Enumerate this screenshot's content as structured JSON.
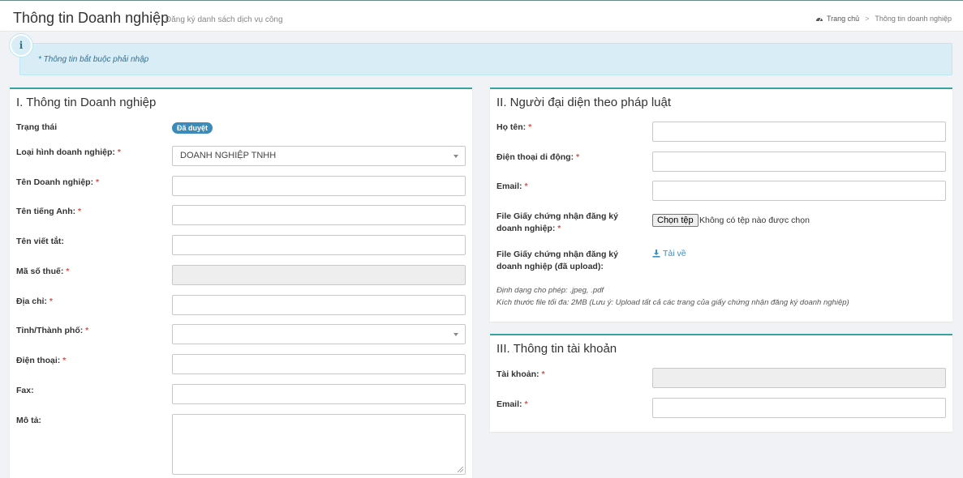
{
  "header": {
    "title": "Thông tin Doanh nghiệp",
    "subtitle": "Đăng ký danh sách dịch vụ công",
    "breadcrumb": {
      "home": "Trang chủ",
      "current": "Thông tin doanh nghiệp"
    }
  },
  "info": {
    "note": "* Thông tin bắt buộc phải nhập",
    "icon": "info-icon"
  },
  "section1": {
    "title": "I. Thông tin Doanh nghiệp",
    "status_label": "Trạng thái",
    "status_badge": "Đã duyệt",
    "status_color": "#3b8bba",
    "business_type_label": "Loại hình doanh nghiệp:",
    "business_type_value": "DOANH NGHIỆP TNHH",
    "name_label": "Tên Doanh nghiệp:",
    "english_name_label": "Tên tiếng Anh:",
    "short_name_label": "Tên viết tắt:",
    "tax_code_label": "Mã số thuế:",
    "address_label": "Địa chỉ:",
    "province_label": "Tỉnh/Thành phố:",
    "province_value": "",
    "phone_label": "Điện thoại:",
    "fax_label": "Fax:",
    "description_label": "Mô tả:"
  },
  "section2": {
    "title": "II. Người đại diện theo pháp luật",
    "fullname_label": "Họ tên:",
    "mobile_label": "Điện thoại di động:",
    "email_label": "Email:",
    "file_label": "File Giấy chứng nhận đăng ký doanh nghiệp:",
    "file_button": "Chọn tệp",
    "file_status": "Không có tệp nào được chọn",
    "uploaded_label": "File Giấy chứng nhận đăng ký doanh nghiệp (đã upload):",
    "download_link": "Tải về",
    "format_hint": "Định dạng cho phép: .jpeg, .pdf",
    "size_hint": "Kích thước file tối đa: 2MB (Lưu ý: Upload tất cả các trang của giấy chứng nhận đăng ký doanh nghiệp)"
  },
  "section3": {
    "title": "III. Thông tin tài khoản",
    "account_label": "Tài khoản:",
    "email_label": "Email:"
  },
  "required_mark": "*",
  "colors": {
    "accent": "#37a2a2",
    "required": "#d9534f",
    "info_bg": "#d9edf7",
    "link": "#3c8dbc"
  }
}
